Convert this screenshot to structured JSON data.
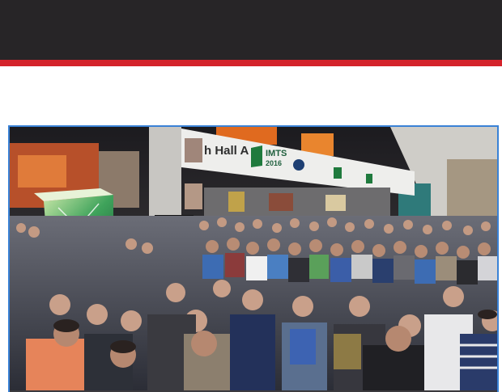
{
  "header": {
    "background_color": "#272527",
    "accent_color": "#d4232b"
  },
  "photo": {
    "frame_color": "#3a82d6",
    "subject": "trade-show-crowd-photo",
    "signage": {
      "hall_label": "h Hall A",
      "show_name_line1": "IMTS",
      "show_name_line2": "2016"
    }
  }
}
